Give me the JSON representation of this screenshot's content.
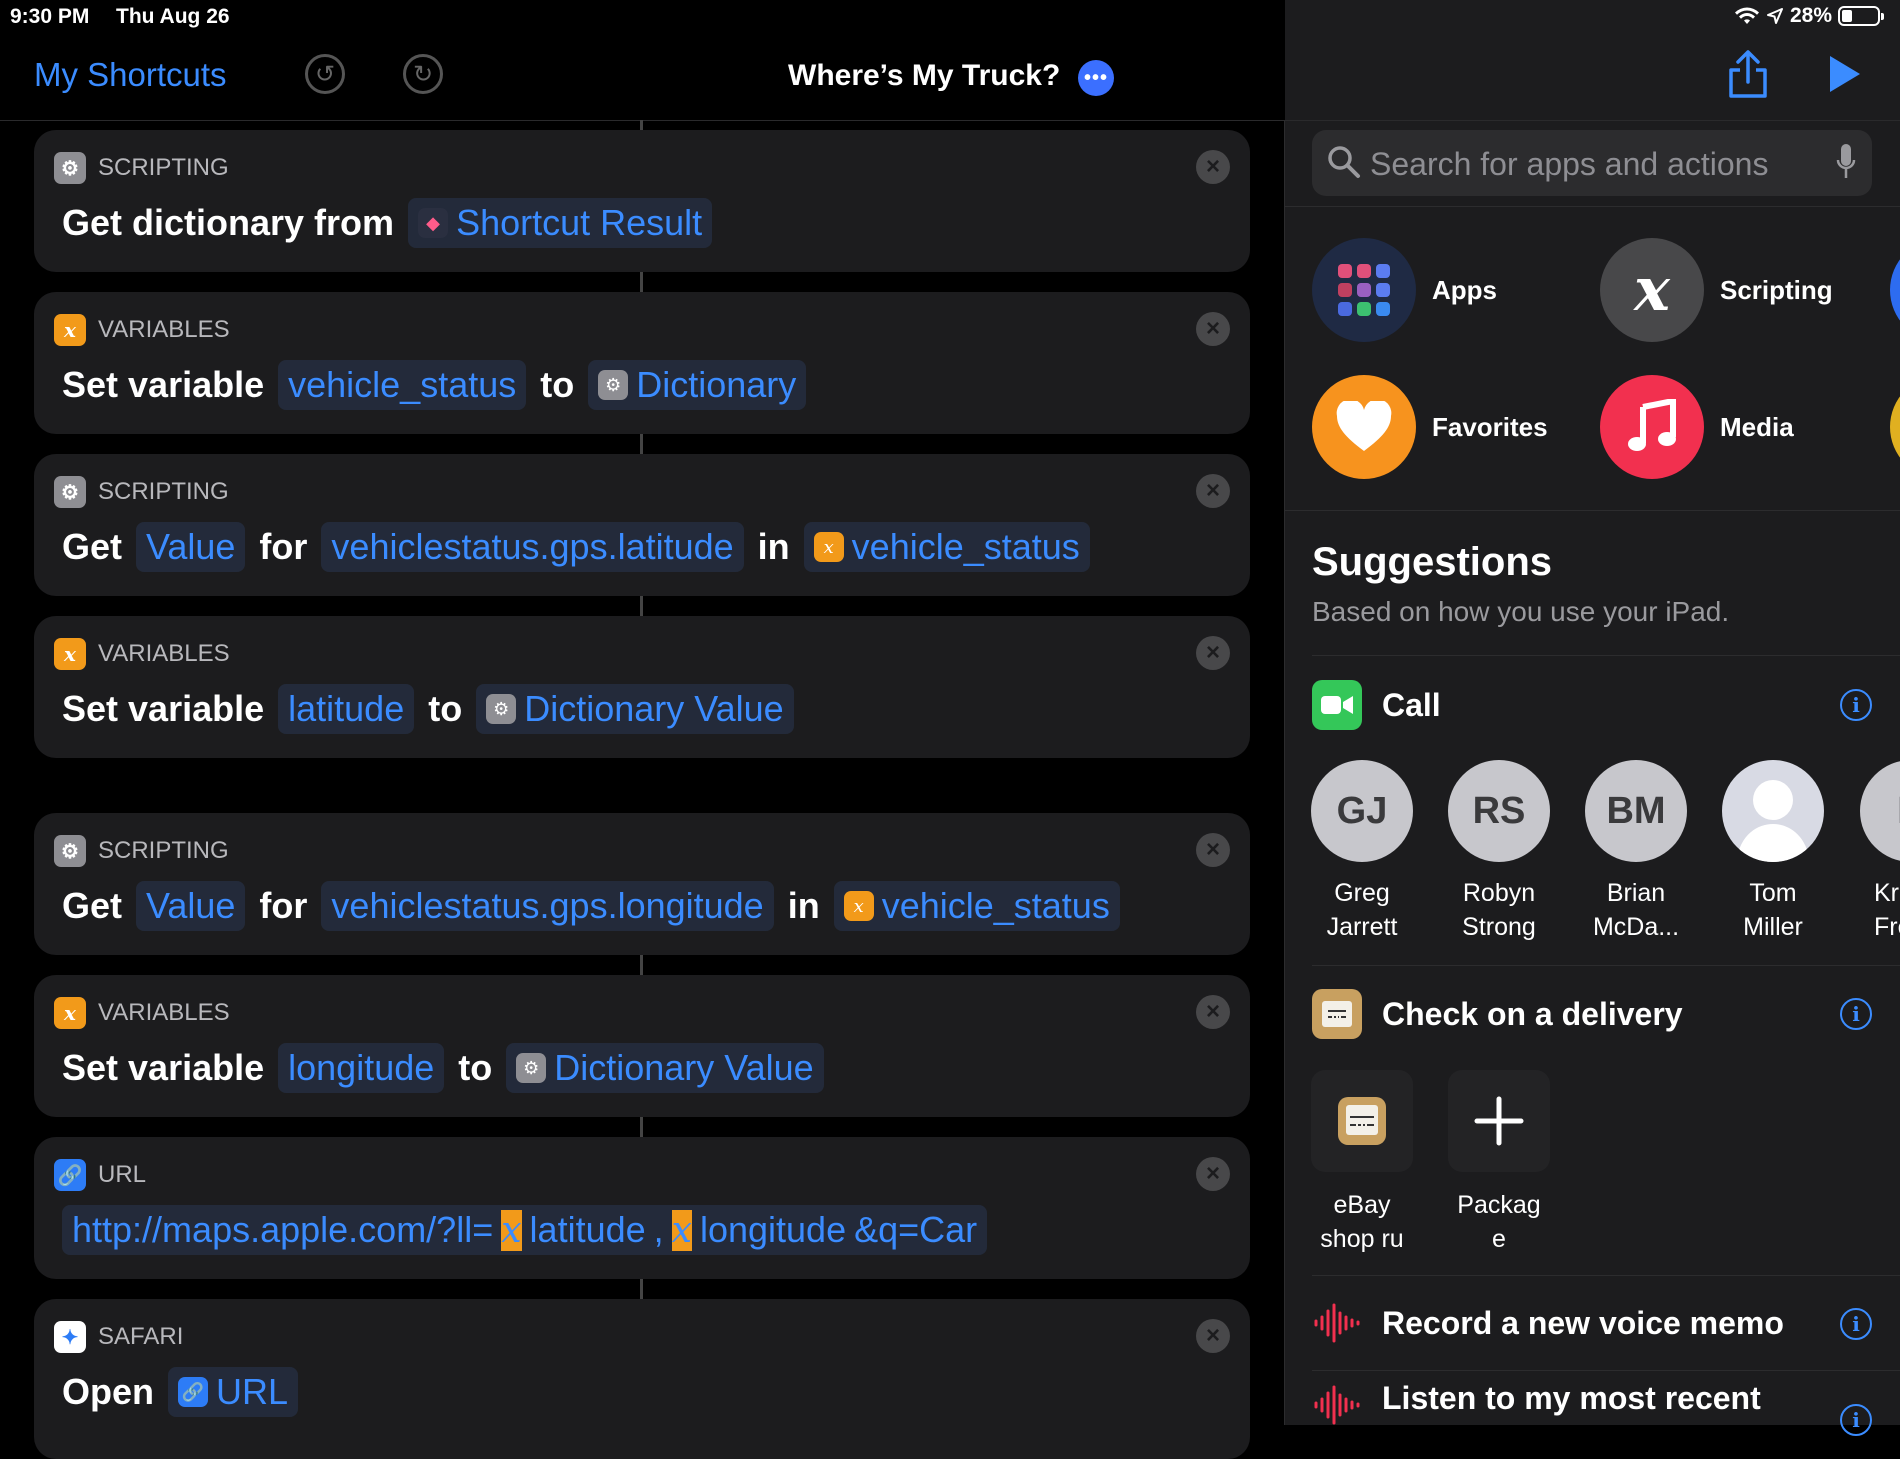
{
  "status": {
    "time": "9:30 PM",
    "date": "Thu Aug 26",
    "battery": "28%",
    "battery_level": 0.28
  },
  "nav": {
    "back_label": "My Shortcuts",
    "title": "Where’s My Truck?",
    "more": "•••"
  },
  "actions": [
    {
      "category": "SCRIPTING",
      "words": [
        "Get dictionary from"
      ],
      "token": "Shortcut Result"
    },
    {
      "category": "VARIABLES",
      "w1": "Set variable",
      "var": "vehicle_status",
      "w2": "to",
      "val": "Dictionary"
    },
    {
      "category": "SCRIPTING",
      "w1": "Get",
      "t1": "Value",
      "w2": "for",
      "t2": "vehiclestatus.gps.latitude",
      "w3": "in",
      "t3": "vehicle_status"
    },
    {
      "category": "VARIABLES",
      "w1": "Set variable",
      "var": "latitude",
      "w2": "to",
      "val": "Dictionary Value"
    },
    {
      "category": "SCRIPTING",
      "w1": "Get",
      "t1": "Value",
      "w2": "for",
      "t2": "vehiclestatus.gps.longitude",
      "w3": "in",
      "t3": "vehicle_status"
    },
    {
      "category": "VARIABLES",
      "w1": "Set variable",
      "var": "longitude",
      "w2": "to",
      "val": "Dictionary Value"
    },
    {
      "category": "URL",
      "p1": "http://maps.apple.com/?ll=",
      "v1": "latitude",
      "sep": ",",
      "v2": "longitude",
      "p2": "&q=Car"
    },
    {
      "category": "SAFARI",
      "w1": "Open",
      "token": "URL"
    }
  ],
  "search": {
    "placeholder": "Search for apps and actions"
  },
  "categories": [
    {
      "label": "Apps",
      "color": "#1f2a44"
    },
    {
      "label": "Scripting",
      "color": "#48484a",
      "glyph": "x"
    },
    {
      "label": "Favorites",
      "color": "#f7931e"
    },
    {
      "label": "Media",
      "color": "#f2304f"
    }
  ],
  "suggestions": {
    "title": "Suggestions",
    "subtitle": "Based on how you use your iPad.",
    "call": {
      "label": "Call",
      "contacts": [
        {
          "initials": "GJ",
          "line1": "Greg",
          "line2": "Jarrett"
        },
        {
          "initials": "RS",
          "line1": "Robyn",
          "line2": "Strong"
        },
        {
          "initials": "BM",
          "line1": "Brian",
          "line2": "McDa..."
        },
        {
          "initials": "",
          "line1": "Tom",
          "line2": "Miller"
        },
        {
          "initials": "K",
          "line1": "Kr",
          "line2": "Fre"
        }
      ]
    },
    "delivery": {
      "label": "Check on a delivery",
      "items": [
        {
          "line1": "eBay",
          "line2": "shop ru"
        },
        {
          "line1": "Packag",
          "line2": "e"
        }
      ]
    },
    "voice": {
      "label": "Record a new voice memo"
    },
    "listen": {
      "label": "Listen to my most recent"
    }
  }
}
